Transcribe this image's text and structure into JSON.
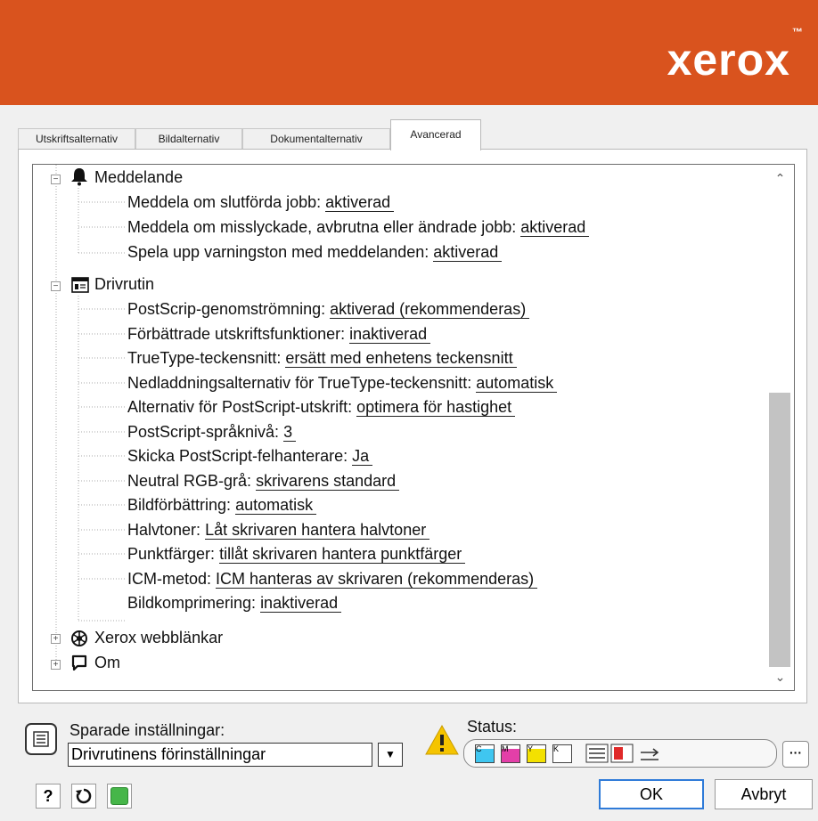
{
  "brand": {
    "name": "xerox",
    "trademark": "™",
    "color": "#d9531e"
  },
  "tabs": [
    {
      "label": "Utskriftsalternativ"
    },
    {
      "label": "Bildalternativ"
    },
    {
      "label": "Dokumentalternativ"
    },
    {
      "label": "Avancerad",
      "active": true
    }
  ],
  "tree": {
    "groups": {
      "notification": {
        "label": "Meddelande",
        "icon": "bell-icon",
        "items": [
          {
            "name": "Meddela om slutförda jobb:",
            "value": "aktiverad"
          },
          {
            "name": "Meddela om misslyckade, avbrutna eller ändrade jobb:",
            "value": "aktiverad"
          },
          {
            "name": "Spela upp varningston med meddelanden:",
            "value": "aktiverad"
          }
        ]
      },
      "driver": {
        "label": "Drivrutin",
        "icon": "driver-icon",
        "items": [
          {
            "name": "PostScrip-genomströmning:",
            "value": "aktiverad (rekommenderas)"
          },
          {
            "name": "Förbättrade utskriftsfunktioner:",
            "value": "inaktiverad "
          },
          {
            "name": "TrueType-teckensnitt:",
            "value": "ersätt med enhetens teckensnitt"
          },
          {
            "name": "Nedladdningsalternativ för TrueType-teckensnitt:",
            "value": "automatisk"
          },
          {
            "name": "Alternativ för PostScript-utskrift:",
            "value": "optimera för hastighet "
          },
          {
            "name": "PostScript-språknivå:",
            "value": "3"
          },
          {
            "name": "Skicka PostScript-felhanterare:",
            "value": "Ja"
          },
          {
            "name": "Neutral RGB-grå:",
            "value": "skrivarens standard "
          },
          {
            "name": "Bildförbättring:",
            "value": "automatisk"
          },
          {
            "name": "Halvtoner:",
            "value": "Låt skrivaren hantera halvtoner "
          },
          {
            "name": "Punktfärger:",
            "value": "tillåt skrivaren hantera punktfärger"
          },
          {
            "name": "ICM-metod:",
            "value": "ICM hanteras av skrivaren (rekommenderas)"
          },
          {
            "name": "Bildkomprimering:",
            "value": "inaktiverad "
          }
        ]
      },
      "weblinks": {
        "label": "Xerox webblänkar",
        "icon": "globe-link-icon"
      },
      "about": {
        "label": "Om",
        "icon": "speech-bubble-icon"
      }
    }
  },
  "saved_settings": {
    "label": "Sparade inställningar:",
    "selected": "Drivrutinens förinställningar"
  },
  "status": {
    "label": "Status:",
    "toner": [
      {
        "letter": "C",
        "color": "#3fc6f0",
        "level": 0.8
      },
      {
        "letter": "M",
        "color": "#e33fa8",
        "level": 0.8
      },
      {
        "letter": "Y",
        "color": "#f3e100",
        "level": 0.8
      },
      {
        "letter": "K",
        "color": "#222222",
        "level": 0.05
      }
    ]
  },
  "buttons": {
    "more": "···",
    "help": "?",
    "ok": "OK",
    "cancel": "Avbryt"
  }
}
